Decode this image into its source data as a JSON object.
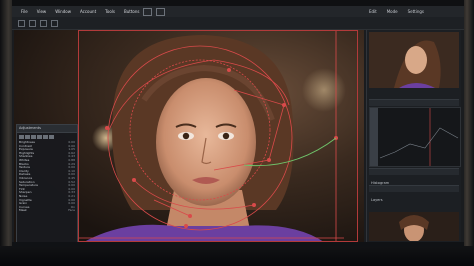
{
  "menu": {
    "items": [
      "File",
      "View",
      "Window",
      "Account",
      "Tools",
      "Buttons"
    ],
    "right_items": [
      "Edit",
      "Mode",
      "Settings"
    ]
  },
  "props_panel": {
    "title": "Adjustments",
    "rows": [
      {
        "label": "Brightness",
        "value": "0.00"
      },
      {
        "label": "Contrast",
        "value": "0.00"
      },
      {
        "label": "Exposure",
        "value": "1.05"
      },
      {
        "label": "Highlights",
        "value": "0.62"
      },
      {
        "label": "Shadows",
        "value": "0.43"
      },
      {
        "label": "Whites",
        "value": "0.88"
      },
      {
        "label": "Blacks",
        "value": "0.29"
      },
      {
        "label": "Texture",
        "value": "0.00"
      },
      {
        "label": "Clarity",
        "value": "0.10"
      },
      {
        "label": "Dehaze",
        "value": "0.00"
      },
      {
        "label": "Vibrance",
        "value": "0.45"
      },
      {
        "label": "Saturation",
        "value": "0.52"
      },
      {
        "label": "Temperature",
        "value": "0.00"
      },
      {
        "label": "Tint",
        "value": "0.00"
      },
      {
        "label": "Sharpen",
        "value": "0.33"
      },
      {
        "label": "Noise",
        "value": "0.21"
      },
      {
        "label": "Vignette",
        "value": "0.00"
      },
      {
        "label": "Grain",
        "value": "0.00"
      },
      {
        "label": "Curves",
        "value": "On"
      },
      {
        "label": "Mask",
        "value": "Face"
      }
    ]
  },
  "right_panel": {
    "section1": "Navigator",
    "section2": "Histogram",
    "section3": "Layers"
  },
  "colors": {
    "accent_red": "#d94a4a",
    "accent_green": "#6fc36a",
    "panel": "#1c1f23"
  }
}
